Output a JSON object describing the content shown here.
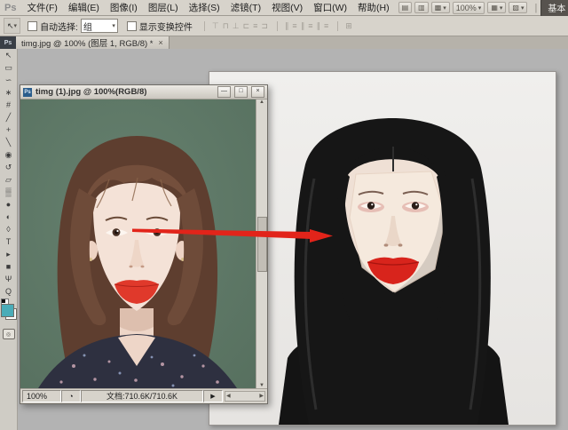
{
  "app": {
    "logo": "Ps",
    "workspace_button": "基本"
  },
  "menubar": {
    "items": [
      {
        "label": "文件(F)"
      },
      {
        "label": "编辑(E)"
      },
      {
        "label": "图像(I)"
      },
      {
        "label": "图层(L)"
      },
      {
        "label": "选择(S)"
      },
      {
        "label": "滤镜(T)"
      },
      {
        "label": "视图(V)"
      },
      {
        "label": "窗口(W)"
      },
      {
        "label": "帮助(H)"
      }
    ]
  },
  "appbar": {
    "icons": [
      {
        "name": "launch-bridge-icon",
        "glyph": "▤"
      },
      {
        "name": "view-extras-icon",
        "glyph": "▥"
      },
      {
        "name": "arrange-documents-icon",
        "glyph": "▩",
        "caret": "▾"
      }
    ],
    "zoom_value": "100%",
    "zoom_caret": "▾",
    "right_icons": [
      {
        "name": "screen-mode-icon",
        "glyph": "▦",
        "caret": "▾"
      },
      {
        "name": "hand-rotate-icon",
        "glyph": "▧",
        "caret": "▾"
      }
    ]
  },
  "optionsbar": {
    "move_tool_glyph": "↖",
    "move_tool_caret": "▾",
    "auto_select_label": "自动选择:",
    "auto_select_value": "组",
    "auto_select_caret": "▾",
    "show_transform_label": "显示变换控件",
    "align_icons": [
      {
        "name": "align-top-icon",
        "glyph": "⊤"
      },
      {
        "name": "align-vcenter-icon",
        "glyph": "⊓"
      },
      {
        "name": "align-bottom-icon",
        "glyph": "⊥"
      },
      {
        "name": "align-left-icon",
        "glyph": "⊏"
      },
      {
        "name": "align-hcenter-icon",
        "glyph": "≡"
      },
      {
        "name": "align-right-icon",
        "glyph": "⊐"
      }
    ],
    "distribute_icons": [
      {
        "name": "distribute-top-icon",
        "glyph": "∥"
      },
      {
        "name": "distribute-vcenter-icon",
        "glyph": "≡"
      },
      {
        "name": "distribute-bottom-icon",
        "glyph": "∥"
      },
      {
        "name": "distribute-left-icon",
        "glyph": "≡"
      },
      {
        "name": "distribute-hcenter-icon",
        "glyph": "∥"
      },
      {
        "name": "distribute-right-icon",
        "glyph": "≡"
      }
    ],
    "auto_align_icon": {
      "name": "auto-align-icon",
      "glyph": "⊞"
    }
  },
  "tabbar": {
    "file_icon_text": "Ps",
    "tab": {
      "label": "timg.jpg @ 100% (图层 1, RGB/8) *",
      "close": "×"
    }
  },
  "toolbar": {
    "tools": [
      {
        "name": "move-tool",
        "glyph": "↖"
      },
      {
        "name": "rectangular-marquee-tool",
        "glyph": "▭"
      },
      {
        "name": "lasso-tool",
        "glyph": "∽"
      },
      {
        "name": "magic-wand-tool",
        "glyph": "∗"
      },
      {
        "name": "crop-tool",
        "glyph": "#"
      },
      {
        "name": "eyedropper-tool",
        "glyph": "╱"
      },
      {
        "name": "spot-healing-tool",
        "glyph": "+"
      },
      {
        "name": "brush-tool",
        "glyph": "╲"
      },
      {
        "name": "clone-stamp-tool",
        "glyph": "◉"
      },
      {
        "name": "history-brush-tool",
        "glyph": "↺"
      },
      {
        "name": "eraser-tool",
        "glyph": "▱"
      },
      {
        "name": "gradient-tool",
        "glyph": "▒"
      },
      {
        "name": "blur-tool",
        "glyph": "●"
      },
      {
        "name": "dodge-tool",
        "glyph": "◐"
      },
      {
        "name": "pen-tool",
        "glyph": "◊"
      },
      {
        "name": "type-tool",
        "glyph": "T"
      },
      {
        "name": "path-selection-tool",
        "glyph": "▸"
      },
      {
        "name": "shape-tool",
        "glyph": "■"
      },
      {
        "name": "hand-tool",
        "glyph": "Ψ"
      },
      {
        "name": "zoom-tool",
        "glyph": "Q"
      }
    ],
    "foreground_color": "#4aacb8",
    "background_color": "#ffffff"
  },
  "floating_window": {
    "icon_text": "Ps",
    "title": "timg (1).jpg @ 100%(RGB/8)",
    "buttons": {
      "minimize": "—",
      "maximize": "□",
      "close": "×"
    },
    "status": {
      "zoom": "100%",
      "doc_info": "文档:710.6K/710.6K",
      "flyout": "▶"
    },
    "scrollbar": {
      "up": "▲",
      "down": "▼",
      "left": "◀",
      "right": "▶"
    }
  },
  "colors": {
    "arrow_red": "#e2241a",
    "photo1_background_green": "#5d7767",
    "photo1_hair_brown": "#6e4b39",
    "photo1_lips_red": "#e0392b",
    "photo2_background_gray": "#ecebe9",
    "photo2_hair_black": "#161616",
    "photo2_lips_red": "#d8241c",
    "chrome_gray": "#d7d3cb",
    "canvas_gray": "#b3b3b3"
  }
}
